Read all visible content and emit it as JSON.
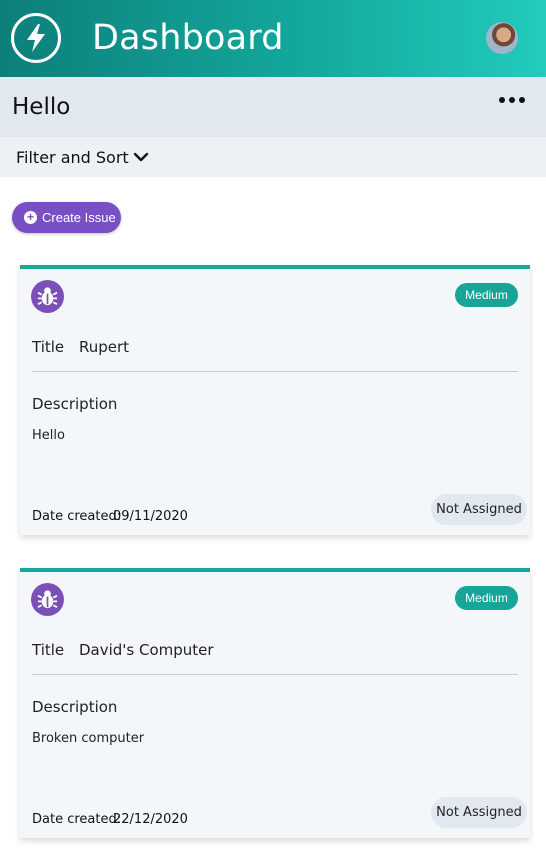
{
  "header": {
    "title": "Dashboard",
    "logo_icon": "lightning-bolt-icon",
    "avatar_icon": "user-avatar"
  },
  "page": {
    "title": "Hello",
    "more_icon": "more-horizontal-icon"
  },
  "filter": {
    "label": "Filter and Sort",
    "icon": "chevron-down-icon"
  },
  "actions": {
    "create_label": "Create Issue",
    "create_icon": "plus-circle-icon"
  },
  "labels": {
    "title": "Title",
    "description": "Description",
    "date_created": "Date created:"
  },
  "issues": [
    {
      "title": "Rupert",
      "description": "Hello",
      "priority": "Medium",
      "date_created": "09/11/2020",
      "assignee": "Not Assigned",
      "icon": "bug-icon"
    },
    {
      "title": "David's Computer",
      "description": "Broken computer",
      "priority": "Medium",
      "date_created": "22/12/2020",
      "assignee": "Not Assigned",
      "icon": "bug-icon"
    }
  ],
  "colors": {
    "header_gradient_start": "#0d7f7a",
    "header_gradient_end": "#22cbbd",
    "accent_purple": "#7950c4",
    "priority_teal": "#16a596"
  }
}
